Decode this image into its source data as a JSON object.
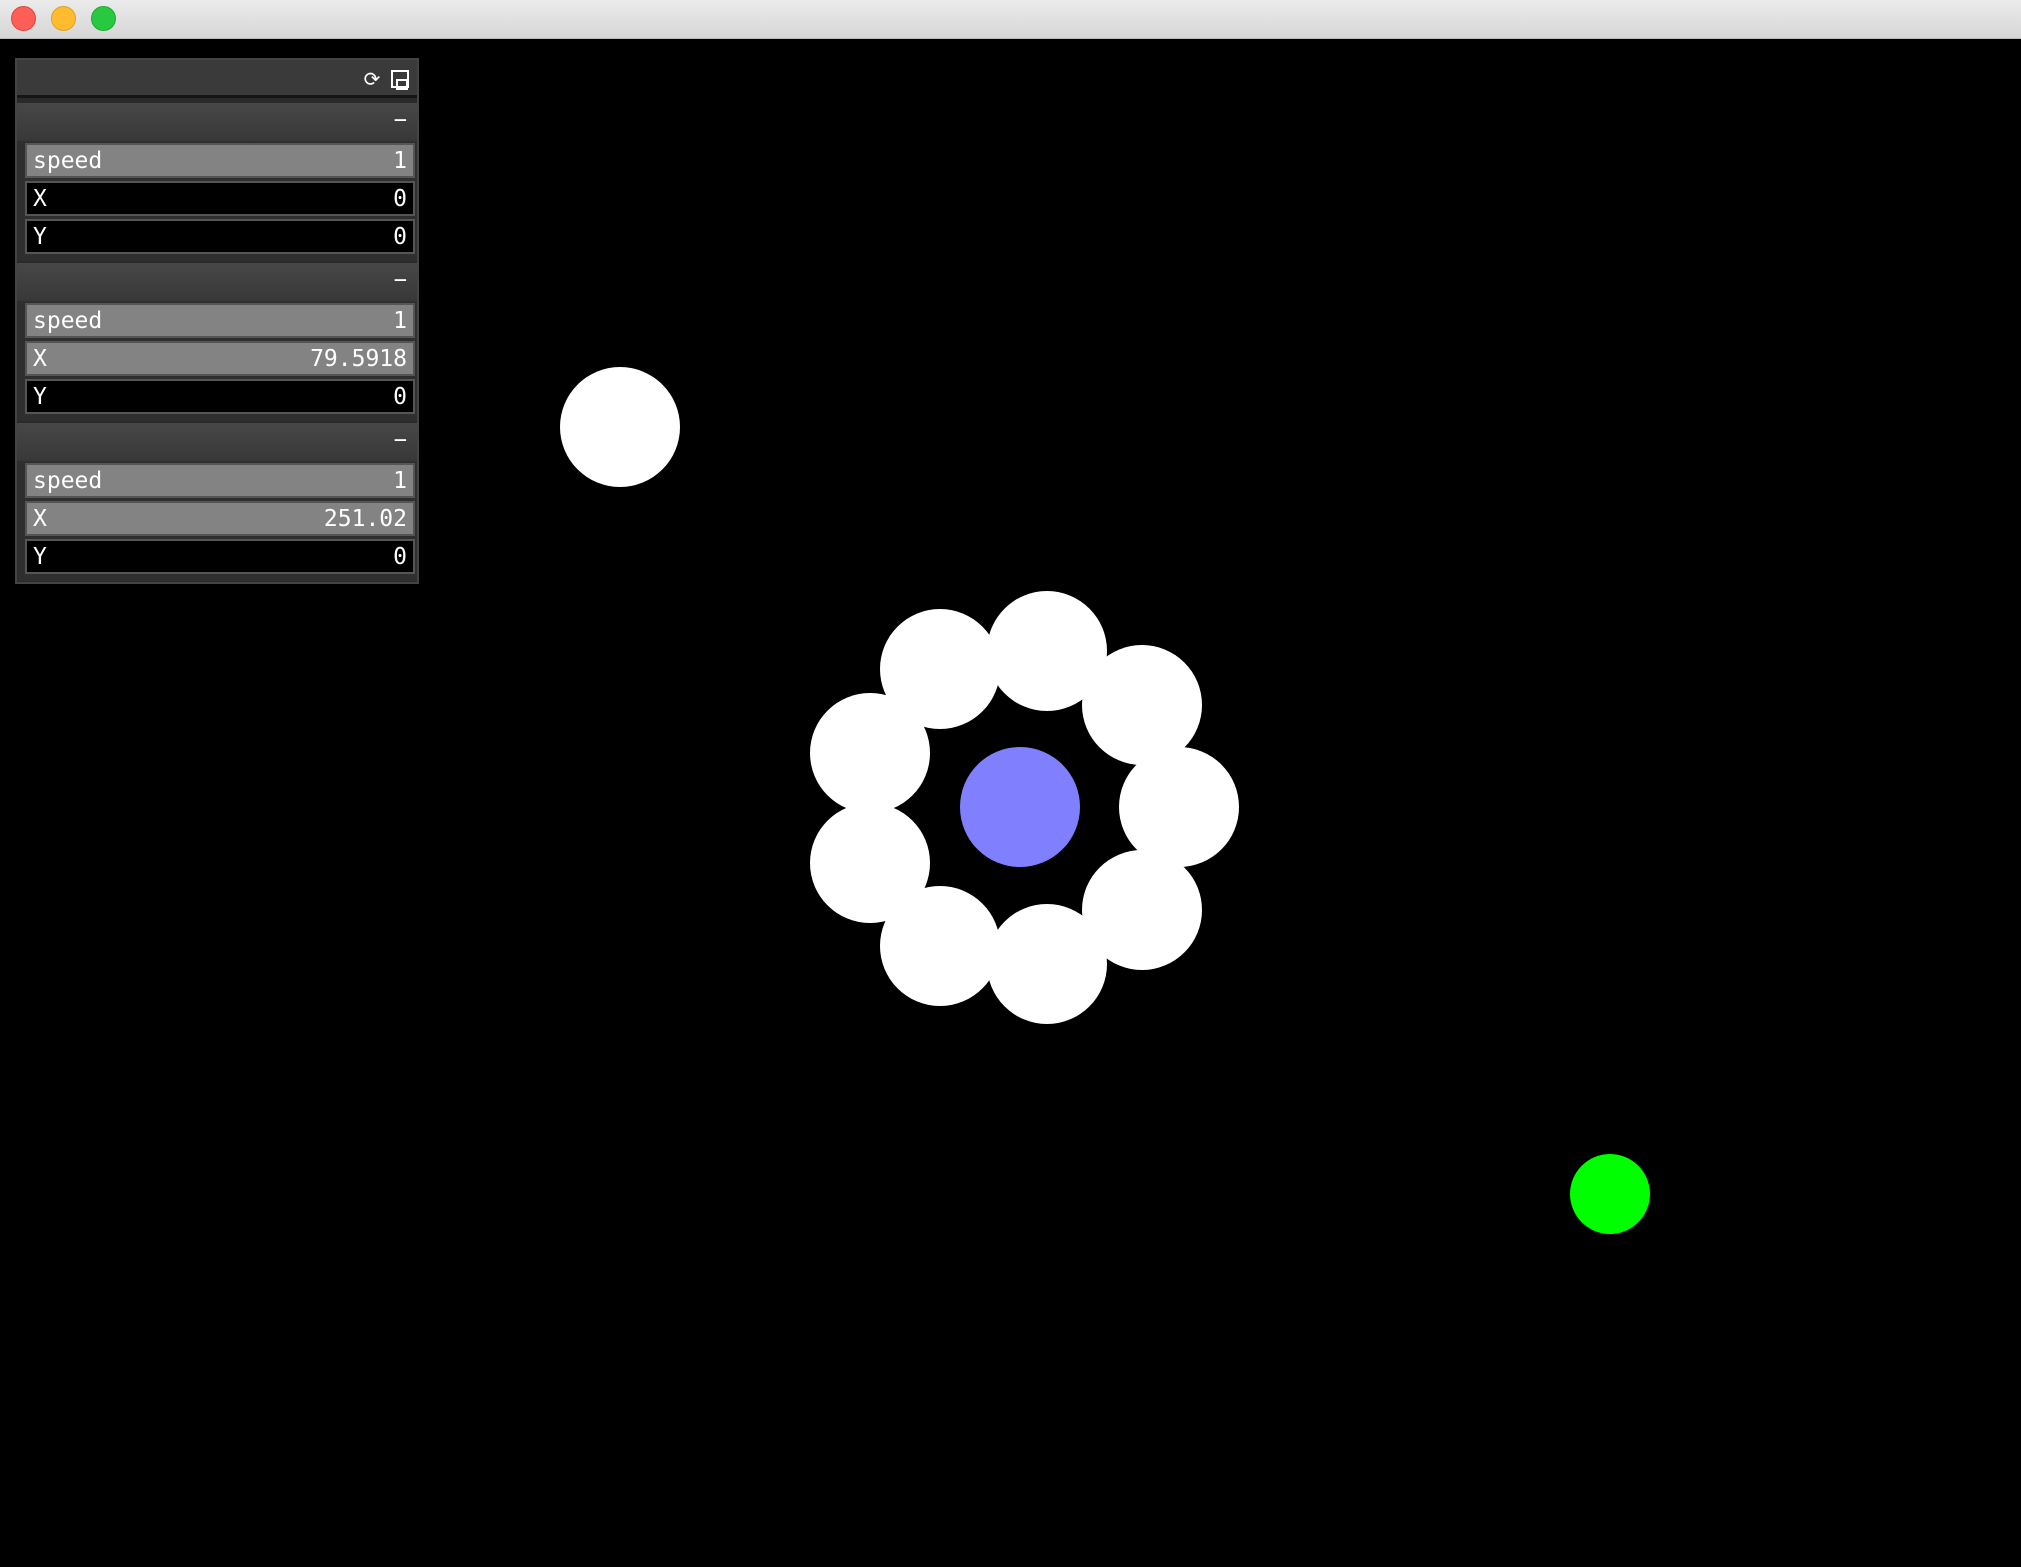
{
  "window": {
    "buttons": [
      "close",
      "minimize",
      "maximize"
    ]
  },
  "panel": {
    "header_icons": [
      "reload-icon",
      "save-icon"
    ],
    "groups": [
      {
        "collapse_label": "−",
        "params": [
          {
            "label": "speed",
            "value": "1",
            "fill_fraction": 1.0
          },
          {
            "label": "X",
            "value": "0",
            "fill_fraction": 0.0
          },
          {
            "label": "Y",
            "value": "0",
            "fill_fraction": 0.0
          }
        ]
      },
      {
        "collapse_label": "−",
        "params": [
          {
            "label": "speed",
            "value": "1",
            "fill_fraction": 1.0
          },
          {
            "label": "X",
            "value": "79.5918",
            "fill_fraction": 1.0
          },
          {
            "label": "Y",
            "value": "0",
            "fill_fraction": 0.0
          }
        ]
      },
      {
        "collapse_label": "−",
        "params": [
          {
            "label": "speed",
            "value": "1",
            "fill_fraction": 1.0
          },
          {
            "label": "X",
            "value": "251.02",
            "fill_fraction": 1.0
          },
          {
            "label": "Y",
            "value": "0",
            "fill_fraction": 0.0
          }
        ]
      }
    ]
  },
  "scene": {
    "colors": {
      "background": "#000000",
      "ball": "#ffffff",
      "center": "#8080ff",
      "marker": "#00ff00"
    }
  }
}
